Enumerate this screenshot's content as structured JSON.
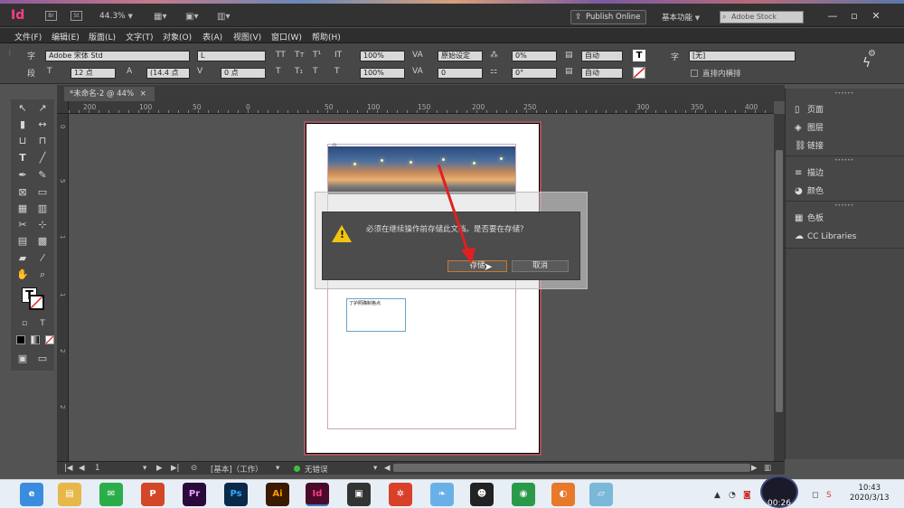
{
  "app": {
    "logo": "Id",
    "zoom": "44.3%",
    "publish_label": "Publish Online",
    "workspace_label": "基本功能",
    "stock_placeholder": "Adobe Stock"
  },
  "menu": [
    "文件(F)",
    "编辑(E)",
    "版面(L)",
    "文字(T)",
    "对象(O)",
    "表(A)",
    "视图(V)",
    "窗口(W)",
    "帮助(H)"
  ],
  "control": {
    "font_name": "Adobe 宋体 Std",
    "font_style": "L",
    "font_size": "12 点",
    "leading": "(14.4 点",
    "kerning": "0 点",
    "scale_v": "100%",
    "scale_h": "100%",
    "tracking": "原始设定",
    "tracking2": "0",
    "skew": "0%",
    "baseline": "0°",
    "lang1": "自动",
    "lang2": "自动",
    "style_none": "[无]",
    "vertical_label": "直排内横排",
    "char_label": "字",
    "para_label": "段"
  },
  "document": {
    "tab_label": "*未命名-2 @ 44%",
    "ruler_top": [
      "200",
      "100",
      "50",
      "0",
      "50",
      "100",
      "150",
      "200",
      "250",
      "300",
      "350",
      "400"
    ],
    "ruler_left": [
      "0",
      "5",
      "1",
      "1",
      "2",
      "2"
    ],
    "text_frame_content": "了护照确制格点"
  },
  "dialog": {
    "message": "必须在继续操作前存储此文档。是否要在存储？",
    "save_label": "存储",
    "cancel_label": "取消"
  },
  "panels": [
    {
      "icon": "page-icon",
      "glyph": "▯",
      "label": "页面"
    },
    {
      "icon": "layers-icon",
      "glyph": "◈",
      "label": "图层"
    },
    {
      "icon": "links-icon",
      "glyph": "⛓",
      "label": "链接"
    },
    {
      "icon": "stroke-icon",
      "glyph": "≡",
      "label": "描边"
    },
    {
      "icon": "color-icon",
      "glyph": "◕",
      "label": "颜色"
    },
    {
      "icon": "swatches-icon",
      "glyph": "▦",
      "label": "色板"
    },
    {
      "icon": "cc-libraries-icon",
      "glyph": "☁",
      "label": "CC Libraries"
    }
  ],
  "status": {
    "page_number": "1",
    "preflight_profile": "[基本]（工作）",
    "errors": "无错误"
  },
  "taskbar": {
    "time": "10:43",
    "date": "2020/3/13",
    "recording_time": "00:26",
    "apps": [
      {
        "name": "browser-icon",
        "label": "e",
        "color": "#3a8dde"
      },
      {
        "name": "file-explorer-icon",
        "label": "▤",
        "color": "#e6b84a"
      },
      {
        "name": "wechat-icon",
        "label": "✉",
        "color": "#2bae4a"
      },
      {
        "name": "powerpoint-icon",
        "label": "P",
        "color": "#d24726"
      },
      {
        "name": "premiere-icon",
        "label": "Pr",
        "color": "#2a0a3a"
      },
      {
        "name": "photoshop-icon",
        "label": "Ps",
        "color": "#0a2a4a"
      },
      {
        "name": "illustrator-icon",
        "label": "Ai",
        "color": "#3a1a00"
      },
      {
        "name": "indesign-icon",
        "label": "Id",
        "color": "#4a0a2a"
      },
      {
        "name": "video-editor-icon",
        "label": "▣",
        "color": "#333"
      },
      {
        "name": "pinwheel-app-icon",
        "label": "✲",
        "color": "#d8402a"
      },
      {
        "name": "bird-app-icon",
        "label": "❧",
        "color": "#6ab0e8"
      },
      {
        "name": "qq-icon",
        "label": "☻",
        "color": "#222"
      },
      {
        "name": "chrome-icon",
        "label": "◉",
        "color": "#2a9a4a"
      },
      {
        "name": "fox-app-icon",
        "label": "◐",
        "color": "#e8782a"
      },
      {
        "name": "notes-app-icon",
        "label": "▱",
        "color": "#7ab8d8"
      }
    ]
  },
  "colors": {
    "indesign_pink": "#ff3d8b",
    "warning_yellow": "#f2c40e",
    "arrow_red": "#e02020",
    "primary_button_border": "#d0772c"
  }
}
